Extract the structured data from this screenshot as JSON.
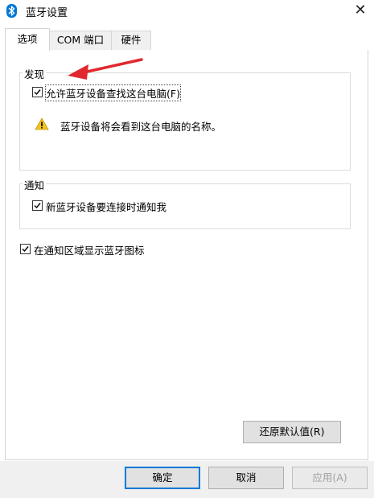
{
  "window": {
    "title": "蓝牙设置",
    "icon": "bluetooth-icon"
  },
  "tabs": [
    {
      "label": "选项",
      "active": true
    },
    {
      "label": "COM 端口",
      "active": false
    },
    {
      "label": "硬件",
      "active": false
    }
  ],
  "discovery": {
    "group_label": "发现",
    "allow_find_label": "允许蓝牙设备查找这台电脑(F)",
    "allow_find_checked": true,
    "warning_text": "蓝牙设备将会看到这台电脑的名称。"
  },
  "notify": {
    "group_label": "通知",
    "notify_label": "新蓝牙设备要连接时通知我",
    "notify_checked": true
  },
  "tray": {
    "label": "在通知区域显示蓝牙图标",
    "checked": true
  },
  "restore_button": "还原默认值(R)",
  "footer": {
    "ok": "确定",
    "cancel": "取消",
    "apply": "应用(A)"
  },
  "colors": {
    "accent": "#0078d7",
    "annotation_arrow": "#e0282e",
    "warning": "#f2c31a"
  }
}
